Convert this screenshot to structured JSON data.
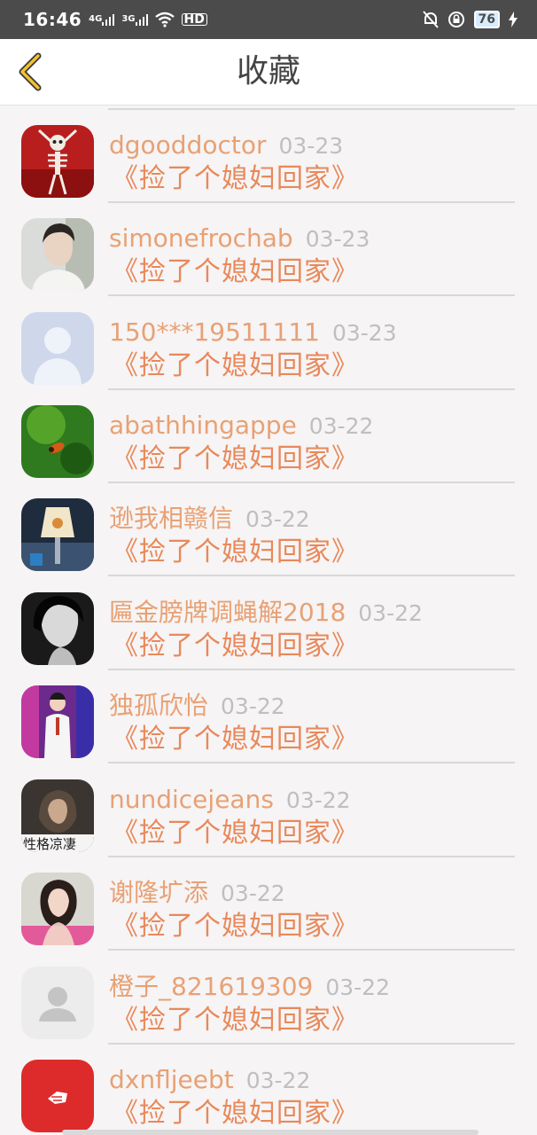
{
  "status_bar": {
    "time": "16:46",
    "net1": "4G",
    "net2": "3G",
    "hd": "HD",
    "battery": "76"
  },
  "header": {
    "title": "收藏",
    "back_icon": "chevron-left-icon"
  },
  "items": [
    {
      "user": "dgooddoctor",
      "date": "03-23",
      "book": "《捡了个媳妇回家》",
      "avatar": "skeleton"
    },
    {
      "user": "simonefrochab",
      "date": "03-23",
      "book": "《捡了个媳妇回家》",
      "avatar": "portrait-man"
    },
    {
      "user": "150***19511111",
      "date": "03-23",
      "book": "《捡了个媳妇回家》",
      "avatar": "default-silhouette-blue"
    },
    {
      "user": "abathhingappe",
      "date": "03-22",
      "book": "《捡了个媳妇回家》",
      "avatar": "green-nature"
    },
    {
      "user": "逊我相赣信",
      "date": "03-22",
      "book": "《捡了个媳妇回家》",
      "avatar": "lamp-photo"
    },
    {
      "user": "匾金膀牌调蝇解2018",
      "date": "03-22",
      "book": "《捡了个媳妇回家》",
      "avatar": "bw-woman"
    },
    {
      "user": "独孤欣怡",
      "date": "03-22",
      "book": "《捡了个媳妇回家》",
      "avatar": "stage-singer"
    },
    {
      "user": "nundicejeans",
      "date": "03-22",
      "book": "《捡了个媳妇回家》",
      "avatar": "dark-portrait-text",
      "avatar_caption": "性格凉凄"
    },
    {
      "user": "谢隆圹添",
      "date": "03-22",
      "book": "《捡了个媳妇回家》",
      "avatar": "girl-pink"
    },
    {
      "user": "橙子_821619309",
      "date": "03-22",
      "book": "《捡了个媳妇回家》",
      "avatar": "default-silhouette-gray"
    },
    {
      "user": "dxnfljeebt",
      "date": "03-22",
      "book": "《捡了个媳妇回家》",
      "avatar": "red-logo"
    }
  ],
  "colors": {
    "username": "#e8a174",
    "book": "#e8895a",
    "date": "#bfbfbf",
    "statusbar": "#4b4b4b",
    "background": "#f6f4f5"
  }
}
